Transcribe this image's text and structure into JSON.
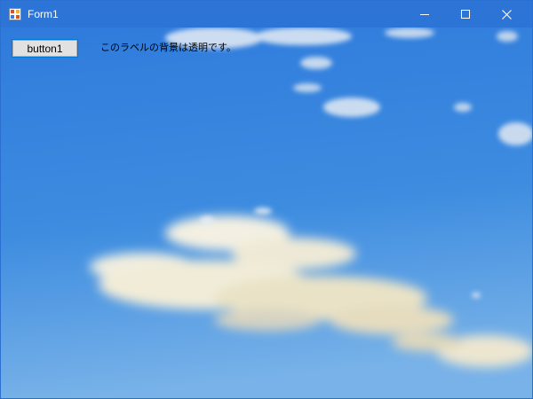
{
  "window": {
    "title": "Form1"
  },
  "titlebar_buttons": {
    "minimize_icon": "minimize-icon",
    "maximize_icon": "maximize-icon",
    "close_icon": "close-icon"
  },
  "form": {
    "button_label": "button1",
    "label_text": "このラベルの背景は透明です。"
  },
  "colors": {
    "titlebar": "#2c74d6",
    "sky_top": "#2f7bdc",
    "sky_bottom": "#73aee8",
    "button_face": "#e1e1e1",
    "button_focus": "#0078d7"
  }
}
